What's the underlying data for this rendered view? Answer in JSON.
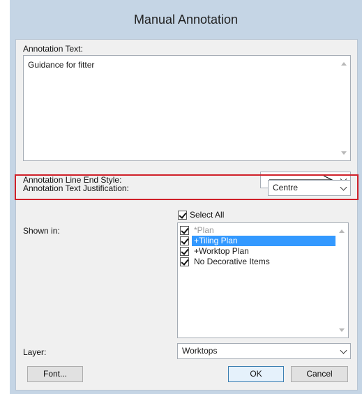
{
  "window": {
    "title": "Manual Annotation"
  },
  "annotation_text": {
    "label": "Annotation Text:",
    "value": "Guidance for fitter"
  },
  "line_end_style": {
    "label": "Annotation Line End Style:",
    "selected_icon": "arrow-right-icon"
  },
  "justification": {
    "label": "Annotation Text Justification:",
    "selected": "Centre"
  },
  "shown_in": {
    "label": "Shown in:",
    "select_all_label": "Select All",
    "items": [
      {
        "label": "*Plan",
        "checked": true,
        "dimmed": true
      },
      {
        "label": "+Tiling Plan",
        "checked": true,
        "selected": true
      },
      {
        "label": "+Worktop Plan",
        "checked": true
      },
      {
        "label": "No Decorative Items",
        "checked": true
      }
    ]
  },
  "layer": {
    "label": "Layer:",
    "selected": "Worktops"
  },
  "buttons": {
    "font": "Font...",
    "ok": "OK",
    "cancel": "Cancel"
  },
  "colors": {
    "highlight_box": "#d0212a",
    "selection": "#3399ff",
    "titlebar": "#c5d5e5"
  }
}
